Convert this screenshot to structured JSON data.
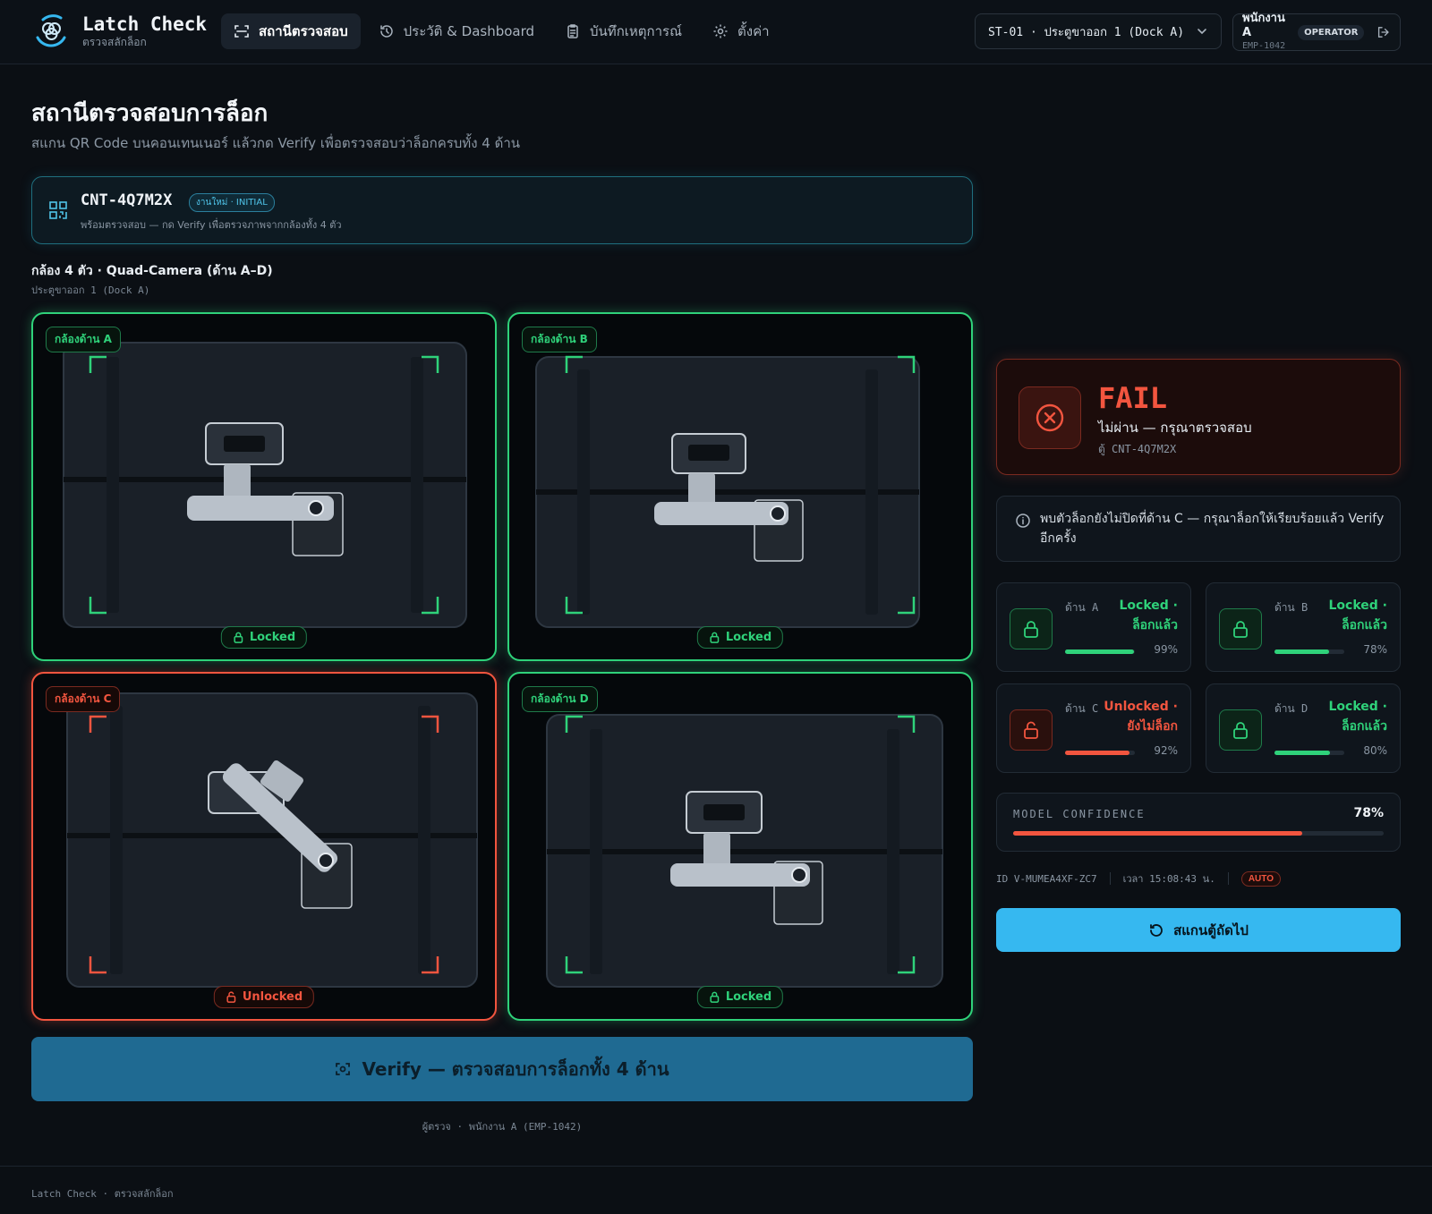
{
  "brand": {
    "title": "Latch Check",
    "subtitle": "ตรวจสลักล็อก"
  },
  "nav": [
    {
      "label": "สถานีตรวจสอบ",
      "icon": "scan-icon",
      "active": true
    },
    {
      "label": "ประวัติ & Dashboard",
      "icon": "history-icon",
      "active": false
    },
    {
      "label": "บันทึกเหตุการณ์",
      "icon": "clipboard-icon",
      "active": false
    },
    {
      "label": "ตั้งค่า",
      "icon": "gear-icon",
      "active": false
    }
  ],
  "station_select": {
    "value": "ST-01 · ประตูขาออก 1 (Dock A)",
    "icon": "chevron-down-icon"
  },
  "user": {
    "name": "พนักงาน A",
    "id": "EMP-1042",
    "role": "OPERATOR",
    "icon": "logout-icon"
  },
  "page": {
    "title": "สถานีตรวจสอบการล็อก",
    "subtitle": "สแกน QR Code บนคอนเทนเนอร์ แล้วกด Verify เพื่อตรวจสอบว่าล็อกครบทั้ง 4 ด้าน"
  },
  "container": {
    "id": "CNT-4Q7M2X",
    "badge": "งานใหม่ · INITIAL",
    "note": "พร้อมตรวจสอบ — กด Verify เพื่อตรวจภาพจากกล้องทั้ง 4 ตัว",
    "icon": "qr-code-icon"
  },
  "cameras": {
    "title": "กล้อง 4 ตัว · Quad-Camera (ด้าน A–D)",
    "location": "ประตูขาออก 1 (Dock A)",
    "panels": [
      {
        "label": "กล้องด้าน A",
        "status": "Locked",
        "state": "locked"
      },
      {
        "label": "กล้องด้าน B",
        "status": "Locked",
        "state": "locked"
      },
      {
        "label": "กล้องด้าน C",
        "status": "Unlocked",
        "state": "unlocked"
      },
      {
        "label": "กล้องด้าน D",
        "status": "Locked",
        "state": "locked"
      }
    ]
  },
  "verify_button": {
    "label": "Verify — ตรวจสอบการล็อกทั้ง 4 ด้าน",
    "icon": "scan-icon"
  },
  "inspector": "ผู้ตรวจ · พนักงาน A (EMP-1042)",
  "result": {
    "title": "FAIL",
    "message": "ไม่ผ่าน — กรุณาตรวจสอบ",
    "container_ref": "ตู้ CNT-4Q7M2X",
    "icon": "x-circle-icon"
  },
  "info": {
    "text": "พบตัวล็อกยังไม่ปิดที่ด้าน C — กรุณาล็อกให้เรียบร้อยแล้ว Verify อีกครั้ง",
    "icon": "info-icon"
  },
  "sides": [
    {
      "name": "ด้าน A",
      "status": "Locked · ล็อกแล้ว",
      "confidence": 99,
      "confidence_label": "99%",
      "state": "locked"
    },
    {
      "name": "ด้าน B",
      "status": "Locked · ล็อกแล้ว",
      "confidence": 78,
      "confidence_label": "78%",
      "state": "locked"
    },
    {
      "name": "ด้าน C",
      "status": "Unlocked · ยังไม่ล็อก",
      "confidence": 92,
      "confidence_label": "92%",
      "state": "unlocked"
    },
    {
      "name": "ด้าน D",
      "status": "Locked · ล็อกแล้ว",
      "confidence": 80,
      "confidence_label": "80%",
      "state": "locked"
    }
  ],
  "model_confidence": {
    "label": "MODEL CONFIDENCE",
    "value": 78,
    "value_label": "78%"
  },
  "meta": {
    "id": "ID V-MUMEA4XF-ZC7",
    "time": "เวลา 15:08:43 น.",
    "mode": "AUTO"
  },
  "next_button": {
    "label": "สแกนตู้ถัดไป",
    "icon": "refresh-icon"
  },
  "footer": "Latch Check · ตรวจสลักล็อก",
  "colors": {
    "ok": "#2fd27a",
    "fail": "#f2553f",
    "accent": "#36b8f0",
    "background": "#0b0f14"
  }
}
